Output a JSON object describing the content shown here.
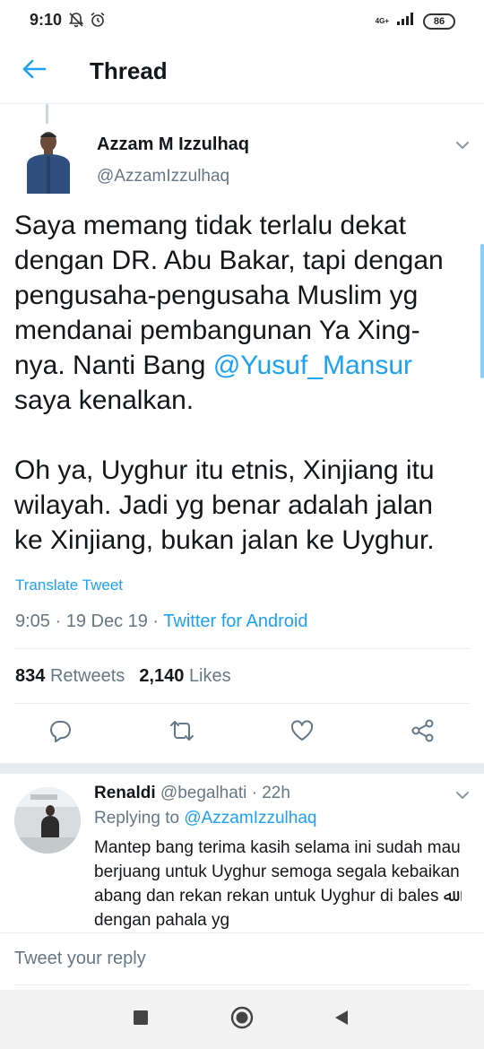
{
  "status_bar": {
    "time": "9:10",
    "network_label": "4G+",
    "battery": "86"
  },
  "header": {
    "title": "Thread"
  },
  "tweet": {
    "author_name": "Azzam M Izzulhaq",
    "author_handle": "@AzzamIzzulhaq",
    "body_p1_part1": "Saya memang tidak terlalu dekat dengan DR. Abu Bakar, tapi dengan pengusaha-pengusaha Muslim yg mendanai pembangunan Ya Xing-nya. Nanti Bang ",
    "mention": "@Yusuf_Mansur",
    "body_p1_part2": " saya kenalkan.",
    "body_p2": "Oh ya, Uyghur itu etnis, Xinjiang itu wilayah. Jadi yg benar adalah jalan ke Xinjiang, bukan jalan ke Uyghur.",
    "translate_label": "Translate Tweet",
    "timestamp": "9:05 · 19 Dec 19 · ",
    "source": "Twitter for Android",
    "retweets_count": "834",
    "retweets_label": "Retweets",
    "likes_count": "2,140",
    "likes_label": "Likes"
  },
  "reply": {
    "name": "Renaldi",
    "handle_time": "@begalhati · 22h",
    "replying_prefix": "Replying to ",
    "replying_to": "@AzzamIzzulhaq",
    "text": "Mantep bang terima kasih selama ini sudah mau berjuang untuk Uyghur semoga segala kebaikan abang dan rekan rekan untuk Uyghur di bales ﷲ dengan pahala yg"
  },
  "compose": {
    "placeholder": "Tweet your reply"
  },
  "colors": {
    "accent": "#1da1f2",
    "secondary_text": "#657786",
    "divider": "#e6ecf0"
  }
}
